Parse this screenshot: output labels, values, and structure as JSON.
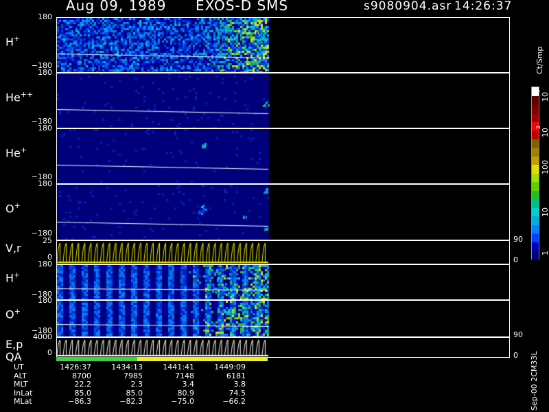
{
  "header": {
    "date": "Aug 09, 1989",
    "instrument": "EXOS-D SMS",
    "file": "s9080904.asr",
    "time": "14:26:37"
  },
  "panels": [
    {
      "id": "h1",
      "species": "H",
      "charge": "+",
      "tick_top": "180",
      "tick_bottom": "−180"
    },
    {
      "id": "he2",
      "species": "He",
      "charge": "++",
      "tick_top": "180",
      "tick_bottom": "−180"
    },
    {
      "id": "he1",
      "species": "He",
      "charge": "+",
      "tick_top": "180",
      "tick_bottom": "−180"
    },
    {
      "id": "o1",
      "species": "O",
      "charge": "+",
      "tick_top": "180",
      "tick_bottom": "−180"
    },
    {
      "id": "vr",
      "label": "V,r",
      "tick_top": "25",
      "tick_bottom": "0",
      "rtick_top": "90",
      "rtick_bottom": "0"
    },
    {
      "id": "h2",
      "species": "H",
      "charge": "+",
      "tick_top": "180",
      "tick_bottom": "−180"
    },
    {
      "id": "o2",
      "species": "O",
      "charge": "+",
      "tick_top": "180",
      "tick_bottom": "−180"
    },
    {
      "id": "ep",
      "label": "E,p",
      "tick_top": "4000",
      "tick_bottom": "0",
      "rtick_top": "90",
      "rtick_bottom": "0"
    }
  ],
  "qa_label": "QA",
  "colorbar": {
    "unit": "Ct/Smp",
    "labels": [
      "1",
      "10",
      "100",
      "10",
      "3",
      "10",
      "4"
    ],
    "colors": [
      "#000080",
      "#0000c0",
      "#0040ff",
      "#0080ff",
      "#00b0e0",
      "#00d0d0",
      "#00c090",
      "#20c020",
      "#60d000",
      "#a0e000",
      "#e0e000",
      "#c0a000",
      "#a08000",
      "#806000",
      "#c00000",
      "#ff0000",
      "#a00000",
      "#800000",
      "#600000",
      "#ffffff"
    ]
  },
  "info": {
    "labels": [
      "UT",
      "ALT",
      "MLT",
      "InLat",
      "MLat"
    ],
    "columns": [
      [
        "1426:37",
        "8700",
        "22.2",
        "85.0",
        "−86.3"
      ],
      [
        "1434:13",
        "7985",
        "2.3",
        "85.0",
        "−82.3"
      ],
      [
        "1441:41",
        "7148",
        "3.4",
        "80.9",
        "−75.0"
      ],
      [
        "1449:09",
        "6181",
        "3.8",
        "74.5",
        "−66.2"
      ]
    ]
  },
  "footer_stamp": "Sep-00 2CM33L",
  "chart_data": {
    "type": "heatmap",
    "title": "Aug 09, 1989   EXOS-D SMS",
    "xlabel": "UT",
    "x": [
      "1426:37",
      "1434:13",
      "1441:41",
      "1449:09"
    ],
    "panels": [
      "H+",
      "He++",
      "He+",
      "O+",
      "V,r",
      "H+",
      "O+",
      "E,p"
    ],
    "ylim": [
      -180,
      180
    ],
    "colorscale_unit": "Ct/Smp",
    "colorscale_range": [
      1,
      10000
    ],
    "colorscale_log": true
  }
}
